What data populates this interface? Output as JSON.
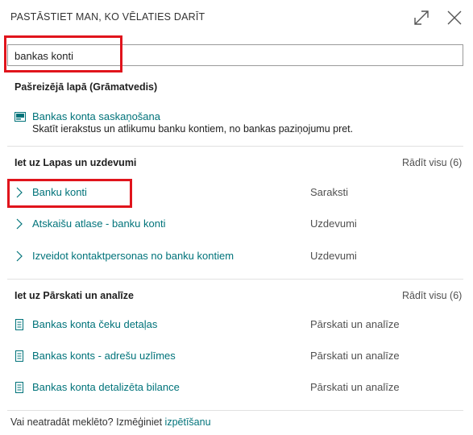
{
  "header": {
    "title": "PASTĀSTIET MAN, KO VĒLATIES DARĪT"
  },
  "search": {
    "value": "bankas konti"
  },
  "current_page": {
    "title": "Pašreizējā lapā (Grāmatvedis)",
    "item": {
      "label": "Bankas konta saskaņošana",
      "description": "Skatīt ierakstus un atlikumu banku kontiem, no bankas paziņojumu pret."
    }
  },
  "pages_tasks": {
    "title": "Iet uz Lapas un uzdevumi",
    "show_all": "Rādīt visu (6)",
    "items": [
      {
        "label": "Banku konti",
        "category": "Saraksti"
      },
      {
        "label": "Atskaišu atlase - banku konti",
        "category": "Uzdevumi"
      },
      {
        "label": "Izveidot kontaktpersonas no banku kontiem",
        "category": "Uzdevumi"
      }
    ]
  },
  "reports": {
    "title": "Iet uz Pārskati un analīze",
    "show_all": "Rādīt visu (6)",
    "items": [
      {
        "label": "Bankas konta čeku detaļas",
        "category": "Pārskati un analīze"
      },
      {
        "label": "Bankas konts - adrešu uzlīmes",
        "category": "Pārskati un analīze"
      },
      {
        "label": "Bankas konta detalizēta bilance",
        "category": "Pārskati un analīze"
      }
    ]
  },
  "footer": {
    "text": "Vai neatradāt meklēto? Izmēģiniet ",
    "link": "izpētīšanu"
  },
  "colors": {
    "link": "#00737a",
    "highlight": "#e0141c",
    "divider": "#e1e1e1"
  },
  "icons": {
    "expand": "expand-icon",
    "close": "close-icon",
    "page": "page-icon",
    "chevron": "chevron-right-icon",
    "report": "report-icon"
  }
}
